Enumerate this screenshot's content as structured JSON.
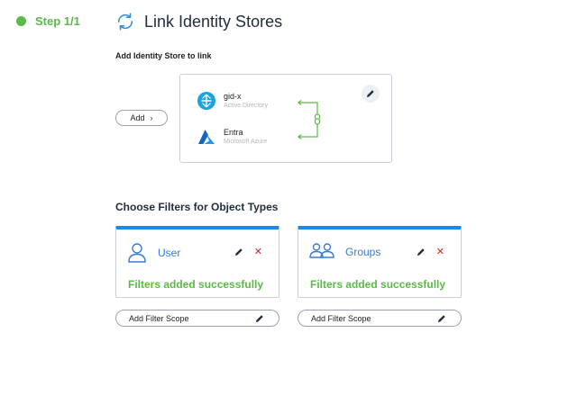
{
  "step": {
    "label": "Step 1/1"
  },
  "header": {
    "title": "Link Identity Stores",
    "icon": "sync-icon"
  },
  "link_section": {
    "label": "Add Identity Store to link",
    "add_button": "Add",
    "stores": [
      {
        "name": "gid-x",
        "subtitle": "Active Directory",
        "icon": "active-directory-icon"
      },
      {
        "name": "Entra",
        "subtitle": "Microsoft Azure",
        "icon": "azure-icon"
      }
    ]
  },
  "filters": {
    "title": "Choose Filters for Object Types",
    "objects": [
      {
        "name": "User",
        "status": "Filters added successfully",
        "scope_button": "Add Filter Scope",
        "icon": "user-icon"
      },
      {
        "name": "Groups",
        "status": "Filters added successfully",
        "scope_button": "Add Filter Scope",
        "icon": "groups-icon"
      }
    ]
  },
  "colors": {
    "accent_green": "#5ab947",
    "accent_blue": "#1e88e5",
    "delete_red": "#c62828",
    "text_dark": "#1f2d3d"
  }
}
